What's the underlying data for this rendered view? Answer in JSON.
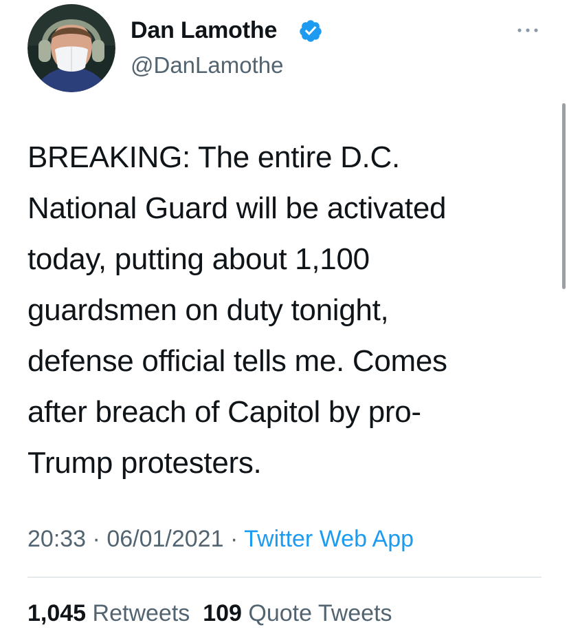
{
  "author": {
    "display_name": "Dan Lamothe",
    "handle": "@DanLamothe",
    "verified_icon": "verified-badge-icon",
    "avatar_icon": "avatar"
  },
  "tweet": {
    "text": "BREAKING: The entire D.C.\nNational Guard will be activated\ntoday, putting about 1,100\nguardsmen on duty tonight,\ndefense official tells me. Comes\nafter breach of Capitol by pro-\nTrump protesters."
  },
  "meta": {
    "time": "20:33",
    "separator": "·",
    "date": "06/01/2021",
    "source": "Twitter Web App"
  },
  "stats": {
    "retweets_count": "1,045",
    "retweets_label": "Retweets",
    "quotes_count": "109",
    "quotes_label": "Quote Tweets"
  },
  "colors": {
    "text": "#0f1419",
    "secondary": "#536471",
    "link": "#1d9bf0",
    "verified": "#1d9bf0"
  },
  "icons": {
    "more": "more-options-icon",
    "verified": "verified-badge-icon"
  }
}
